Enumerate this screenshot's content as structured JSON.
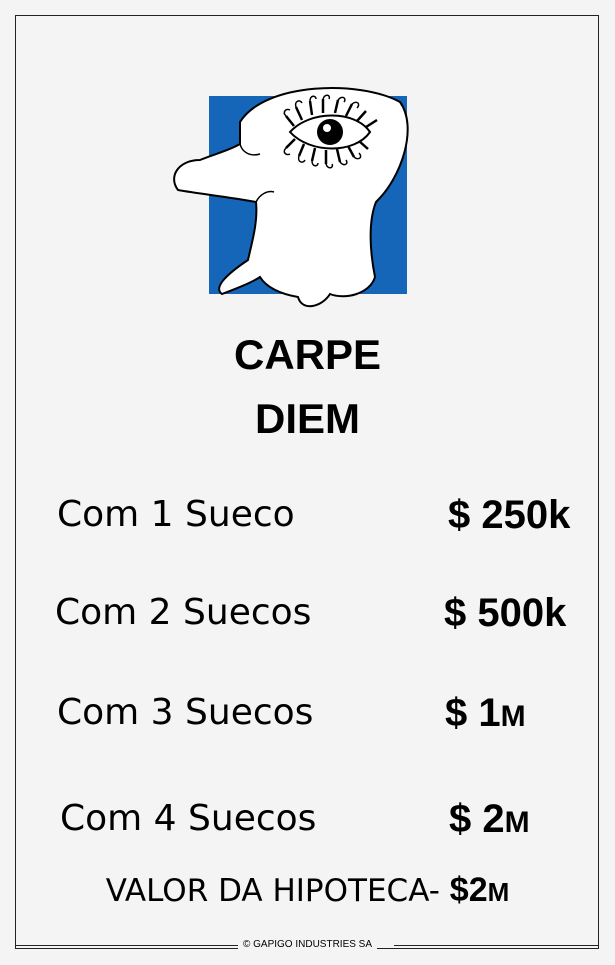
{
  "card": {
    "title_line1": "CARPE",
    "title_line2": "DIEM",
    "rows": [
      {
        "label": "Com 1 Sueco",
        "amount": "$ 250k",
        "amount_main": "$ 250k",
        "amount_suffix": ""
      },
      {
        "label": "Com 2 Suecos",
        "amount": "$ 500k",
        "amount_main": "$ 500k",
        "amount_suffix": ""
      },
      {
        "label": "Com 3 Suecos",
        "amount": "$ 1M",
        "amount_main": "$ 1",
        "amount_suffix": "M"
      },
      {
        "label": "Com 4 Suecos",
        "amount": "$ 2M",
        "amount_main": "$ 2",
        "amount_suffix": "M"
      }
    ],
    "mortgage_label": "VALOR DA HIPOTECA-",
    "mortgage_value_main": "$2",
    "mortgage_value_suffix": "M",
    "footer": "© GAPIGO INDUSTRIES SA",
    "illustration_icon": "one-eyed-ghost-creature-icon",
    "colors": {
      "background": "#f4f4f4",
      "illustration_square": "#1565b8",
      "border": "#222222"
    }
  }
}
